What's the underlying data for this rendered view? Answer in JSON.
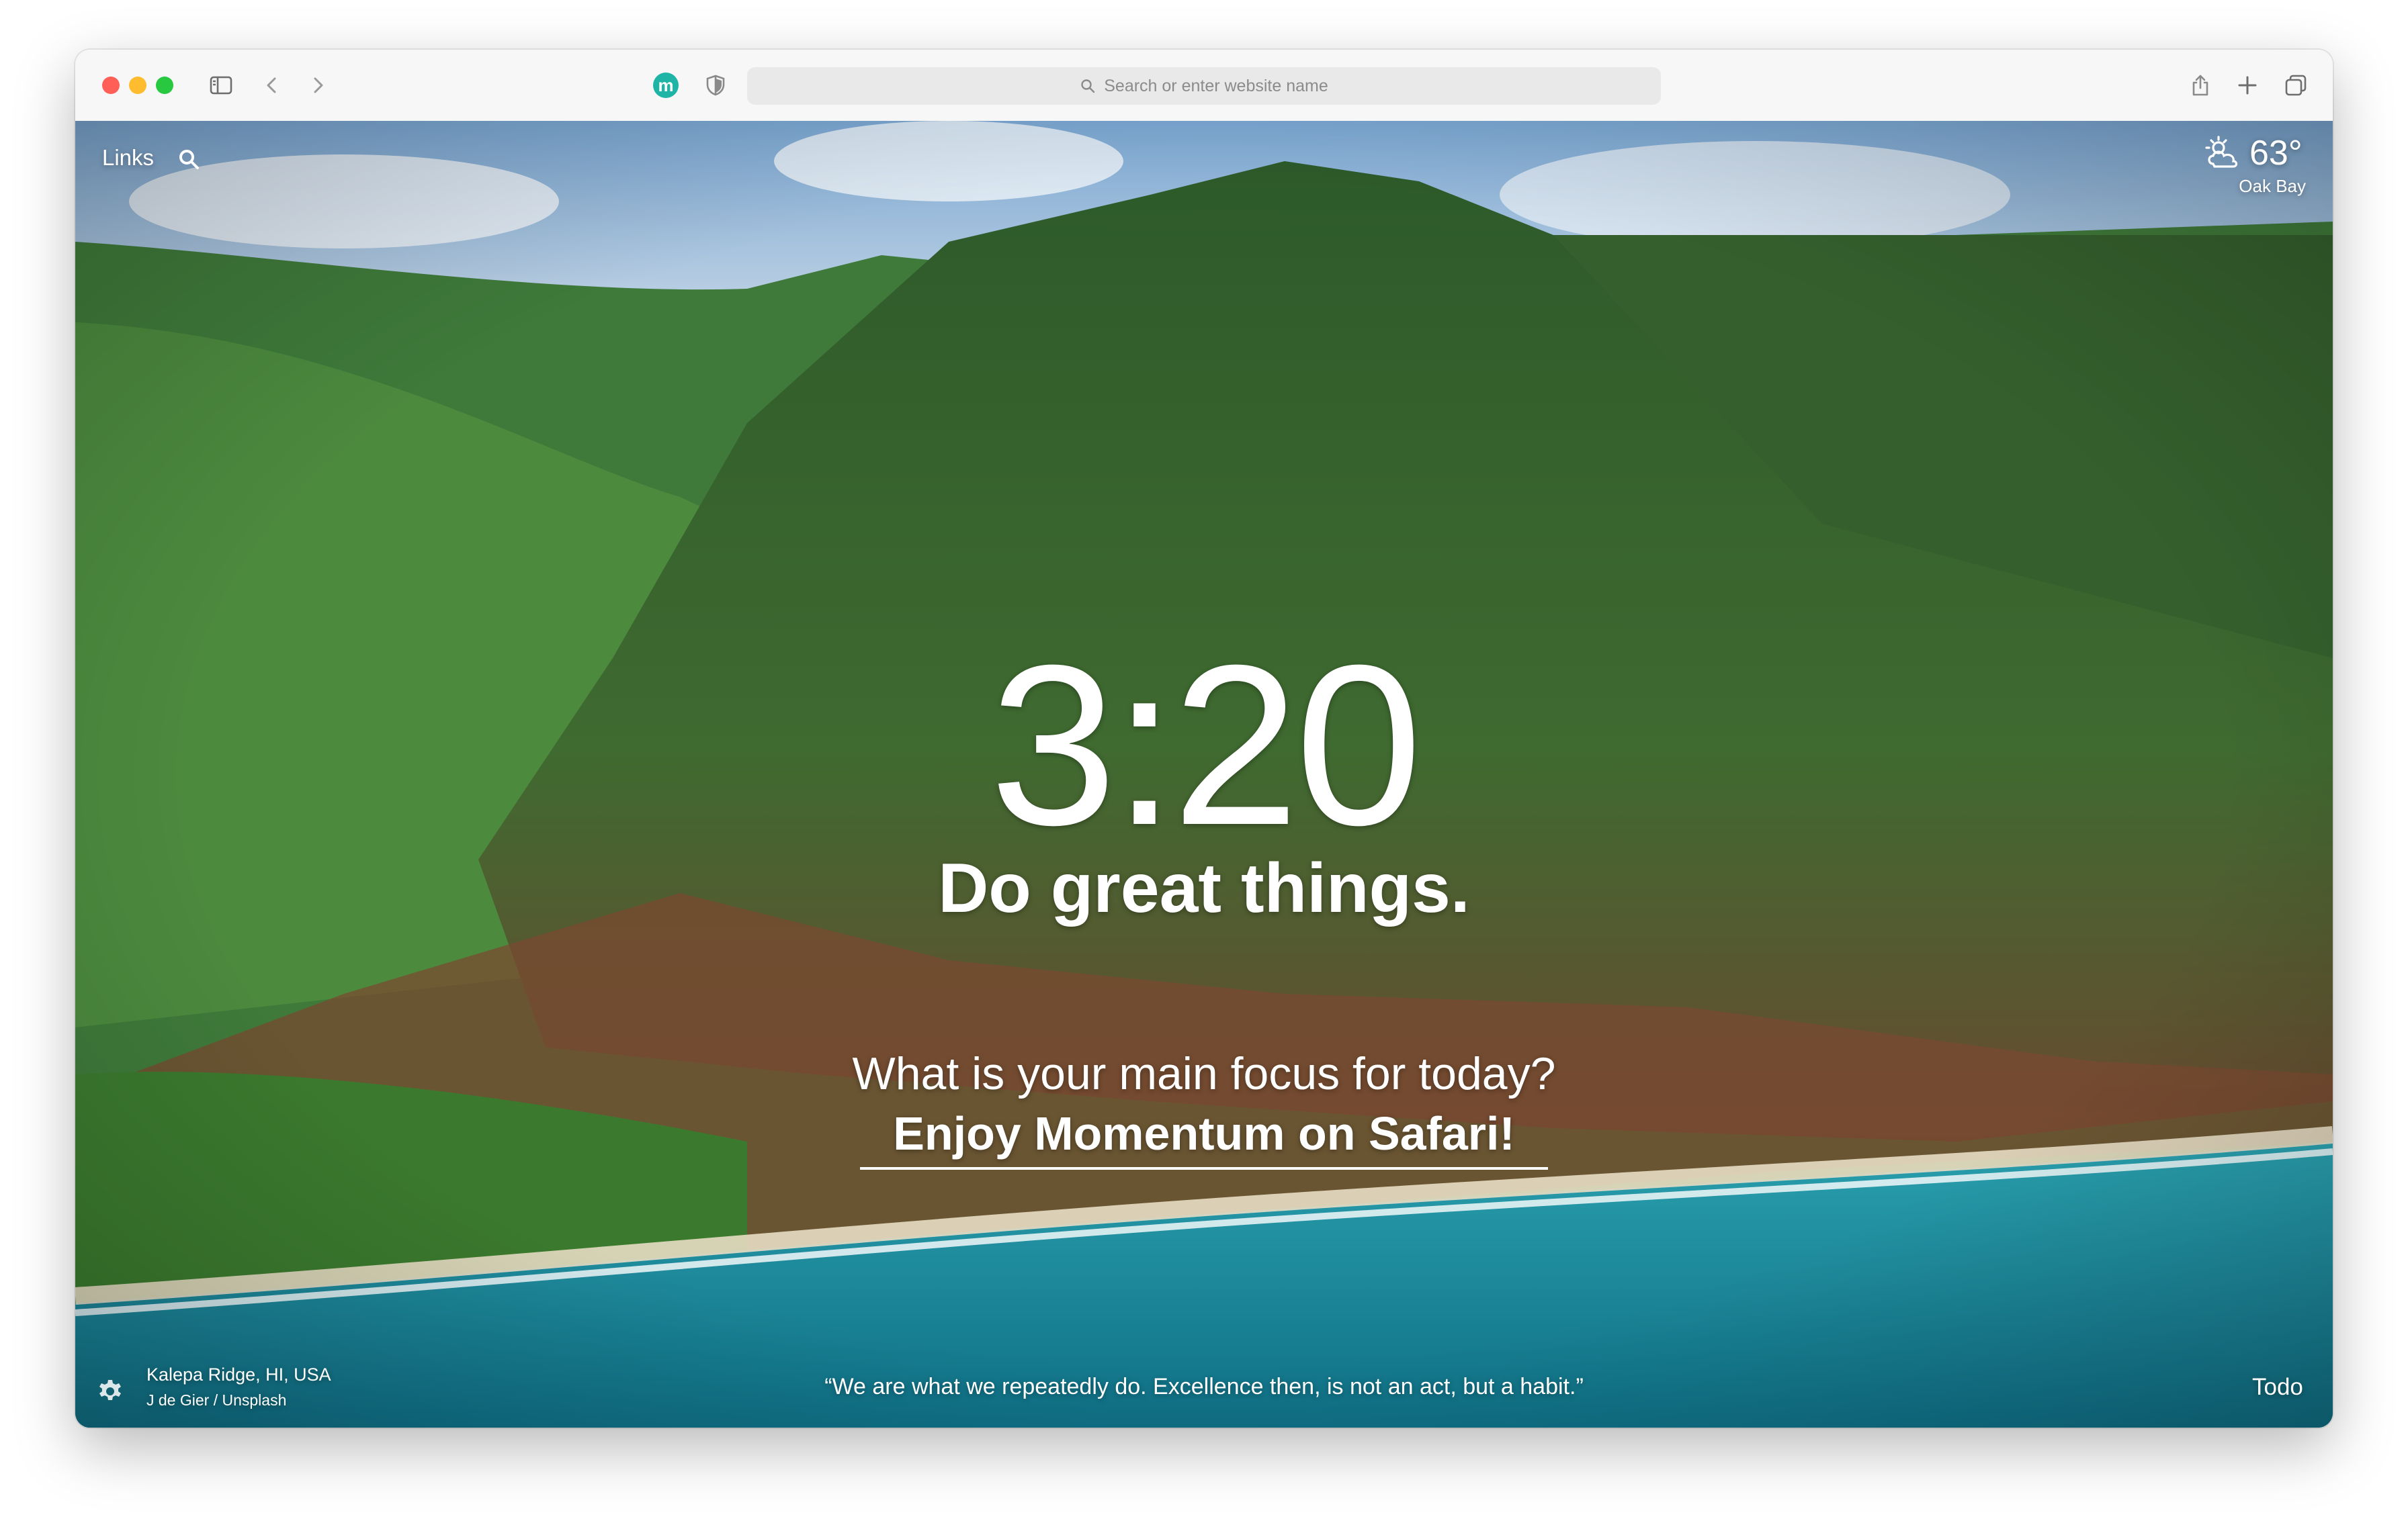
{
  "browser": {
    "address_placeholder": "Search or enter website name",
    "extension_badge": "m"
  },
  "dashboard": {
    "links_label": "Links",
    "weather": {
      "temperature": "63°",
      "location": "Oak Bay",
      "icon": "partly-cloudy-sun-icon"
    },
    "clock": "3:20",
    "greeting": "Do great things.",
    "focus_question": "What is your main focus for today?",
    "focus_answer": "Enjoy Momentum on Safari!",
    "photo": {
      "title": "Kalepa Ridge, HI, USA",
      "credit": "J de Gier / Unsplash"
    },
    "quote": "“We are what we repeatedly do. Excellence then, is not an act, but a habit.”",
    "todo_label": "Todo"
  },
  "colors": {
    "accent_extension": "#1fb5a6",
    "traffic_red": "#ff5f57",
    "traffic_yellow": "#febc2e",
    "traffic_green": "#28c840"
  }
}
